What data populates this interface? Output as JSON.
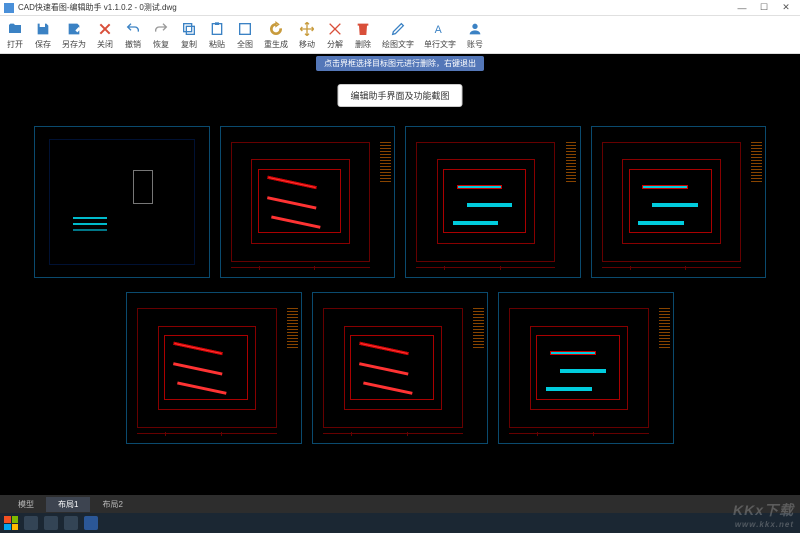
{
  "window": {
    "title": "CAD快速看图-编辑助手 v1.1.0.2 - 0测试.dwg"
  },
  "toolbar": [
    {
      "id": "open",
      "label": "打开",
      "color": "#3b82c4"
    },
    {
      "id": "save",
      "label": "保存",
      "color": "#3b82c4"
    },
    {
      "id": "saveas",
      "label": "另存为",
      "color": "#3b82c4"
    },
    {
      "id": "close",
      "label": "关闭",
      "color": "#d94f3a"
    },
    {
      "id": "undo",
      "label": "撤销",
      "color": "#3b82c4"
    },
    {
      "id": "redo",
      "label": "恢复",
      "color": "#999"
    },
    {
      "id": "copy",
      "label": "复制",
      "color": "#3b82c4"
    },
    {
      "id": "paste",
      "label": "粘贴",
      "color": "#3b82c4"
    },
    {
      "id": "full",
      "label": "全图",
      "color": "#3b82c4"
    },
    {
      "id": "regen",
      "label": "重生成",
      "color": "#c89b3c"
    },
    {
      "id": "move",
      "label": "移动",
      "color": "#c89b3c"
    },
    {
      "id": "explode",
      "label": "分解",
      "color": "#d94f3a"
    },
    {
      "id": "delete",
      "label": "删除",
      "color": "#d94f3a"
    },
    {
      "id": "draw",
      "label": "绘图文字",
      "color": "#3b82c4"
    },
    {
      "id": "stext",
      "label": "单行文字",
      "color": "#3b82c4"
    },
    {
      "id": "account",
      "label": "账号",
      "color": "#3b82c4"
    }
  ],
  "canvas": {
    "hint": "点击界框选择目标图元进行删除，右键退出",
    "center_button": "编辑助手界面及功能截图"
  },
  "thumbs_row1": [
    {
      "kind": "legend"
    },
    {
      "kind": "plan-red"
    },
    {
      "kind": "plan-cyan"
    },
    {
      "kind": "plan-cyan"
    }
  ],
  "thumbs_row2": [
    {
      "kind": "plan-red"
    },
    {
      "kind": "plan-red"
    },
    {
      "kind": "plan-cyan"
    }
  ],
  "tabs": [
    {
      "label": "模型",
      "active": false
    },
    {
      "label": "布局1",
      "active": true
    },
    {
      "label": "布局2",
      "active": false
    }
  ],
  "watermark": {
    "main": "KKx下载",
    "sub": "www.kkx.net"
  }
}
